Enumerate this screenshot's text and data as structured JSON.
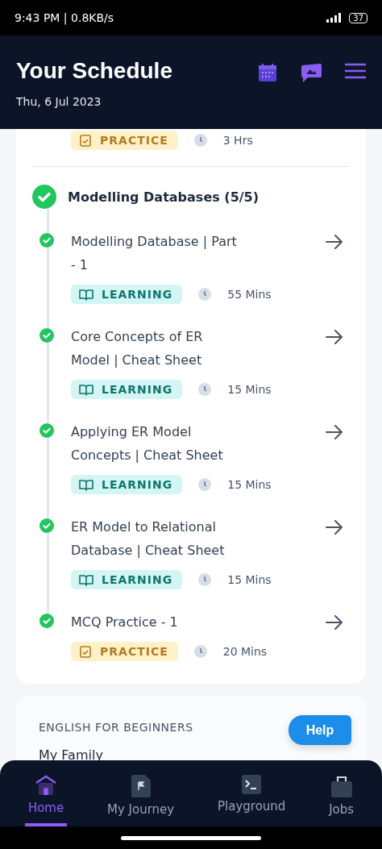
{
  "status_bar": {
    "time": "9:43 PM | 0.8KB/s",
    "battery": "37"
  },
  "header": {
    "title": "Your Schedule",
    "date": "Thu, 6 Jul 2023"
  },
  "previous_item": {
    "kind": "practice",
    "tag": "PRACTICE",
    "duration": "3 Hrs"
  },
  "section": {
    "title": "Modelling Databases (5/5)",
    "completed": true,
    "items": [
      {
        "title": "Modelling Database | Part - 1",
        "kind": "learning",
        "tag": "LEARNING",
        "duration": "55 Mins",
        "completed": true
      },
      {
        "title": "Core Concepts of ER Model | Cheat Sheet",
        "kind": "learning",
        "tag": "LEARNING",
        "duration": "15 Mins",
        "completed": true
      },
      {
        "title": "Applying ER Model Concepts | Cheat Sheet",
        "kind": "learning",
        "tag": "LEARNING",
        "duration": "15 Mins",
        "completed": true
      },
      {
        "title": "ER Model to Relational Database | Cheat Sheet",
        "kind": "learning",
        "tag": "LEARNING",
        "duration": "15 Mins",
        "completed": true
      },
      {
        "title": "MCQ Practice - 1",
        "kind": "practice",
        "tag": "PRACTICE",
        "duration": "20 Mins",
        "completed": true
      }
    ]
  },
  "next_course": {
    "title": "ENGLISH FOR BEGINNERS",
    "first_item": "My Family"
  },
  "help_button": "Help",
  "bottom_nav": [
    {
      "label": "Home",
      "kind": "home",
      "selected": true
    },
    {
      "label": "My Journey",
      "kind": "journey",
      "selected": false
    },
    {
      "label": "Playground",
      "kind": "playground",
      "selected": false
    },
    {
      "label": "Jobs",
      "kind": "jobs",
      "selected": false
    }
  ]
}
